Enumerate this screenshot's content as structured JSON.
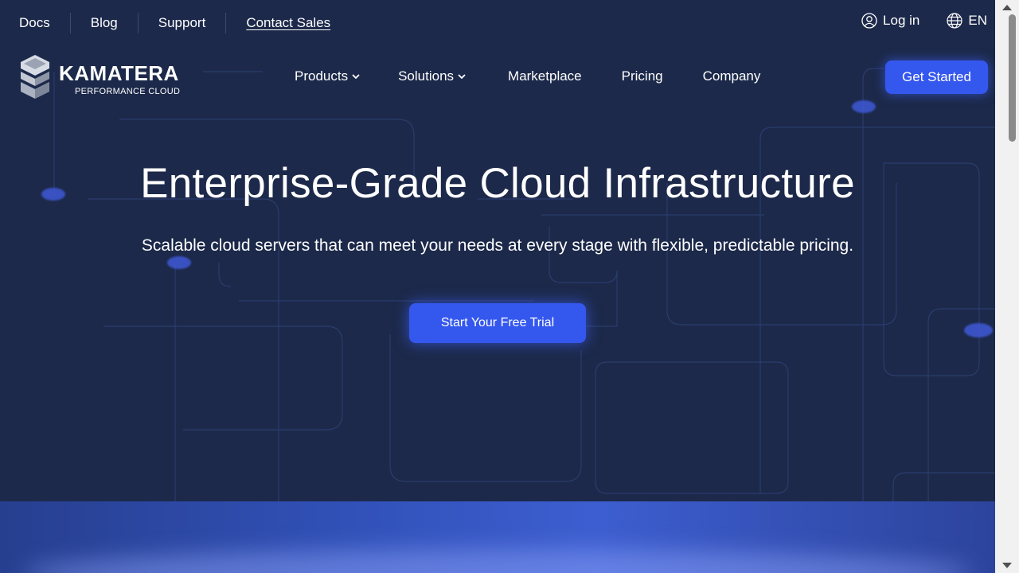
{
  "topbar": {
    "links": [
      {
        "label": "Docs"
      },
      {
        "label": "Blog"
      },
      {
        "label": "Support"
      },
      {
        "label": "Contact Sales"
      }
    ],
    "login_label": "Log in",
    "login_icon": "user-icon",
    "language_label": "EN",
    "language_icon": "globe-icon"
  },
  "logo": {
    "name": "KAMATERA",
    "tagline": "PERFORMANCE CLOUD"
  },
  "nav": {
    "items": [
      {
        "label": "Products",
        "has_dropdown": true
      },
      {
        "label": "Solutions",
        "has_dropdown": true
      },
      {
        "label": "Marketplace",
        "has_dropdown": false
      },
      {
        "label": "Pricing",
        "has_dropdown": false
      },
      {
        "label": "Company",
        "has_dropdown": false
      }
    ],
    "cta_label": "Get Started"
  },
  "hero": {
    "title": "Enterprise-Grade Cloud Infrastructure",
    "subtitle": "Scalable cloud servers that can meet your needs at every stage with flexible, predictable pricing.",
    "cta_label": "Start Your Free Trial"
  },
  "colors": {
    "background": "#1c294a",
    "accent": "#3457ee",
    "text": "#ffffff"
  }
}
